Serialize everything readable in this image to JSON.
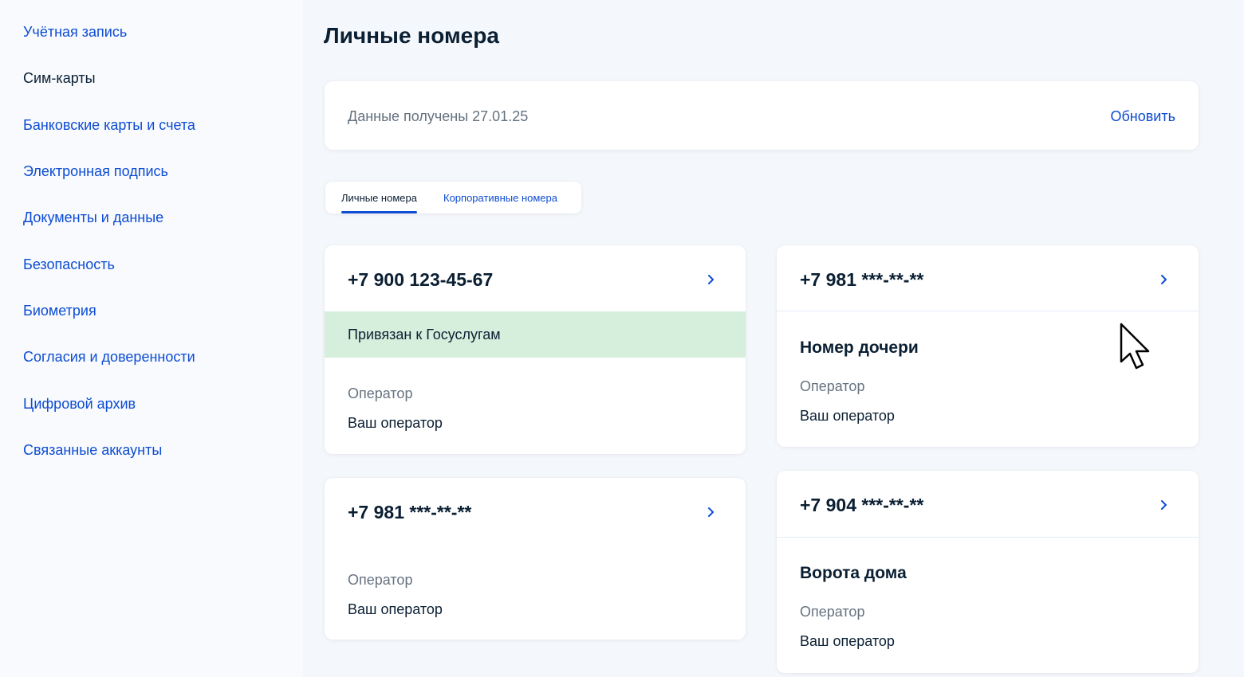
{
  "sidebar": {
    "items": [
      {
        "label": "Учётная запись"
      },
      {
        "label": "Сим-карты"
      },
      {
        "label": "Банковские карты и счета"
      },
      {
        "label": "Электронная подпись"
      },
      {
        "label": "Документы и данные"
      },
      {
        "label": "Безопасность"
      },
      {
        "label": "Биометрия"
      },
      {
        "label": "Согласия и доверенности"
      },
      {
        "label": "Цифровой архив"
      },
      {
        "label": "Связанные аккаунты"
      }
    ],
    "active_item": "Сим-карты"
  },
  "page": {
    "title": "Личные номера"
  },
  "status": {
    "text": "Данные получены 27.01.25",
    "refresh_label": "Обновить"
  },
  "tabs": {
    "personal": "Личные номера",
    "corporate": "Корпоративные номера",
    "active": "personal"
  },
  "phones": [
    {
      "number": "+7 900 123-45-67",
      "linked_text": "Привязан к Госуслугам",
      "operator_label": "Оператор",
      "operator_value": "Ваш оператор"
    },
    {
      "number": "+7 981 ***-**-**",
      "label": "Номер дочери",
      "operator_label": "Оператор",
      "operator_value": "Ваш оператор"
    },
    {
      "number": "+7 981 ***-**-**",
      "operator_label": "Оператор",
      "operator_value": "Ваш оператор"
    },
    {
      "number": "+7 904 ***-**-**",
      "label": "Ворота дома",
      "operator_label": "Оператор",
      "operator_value": "Ваш оператор"
    }
  ],
  "colors": {
    "accent": "#0d4cd3",
    "text": "#0b1f33",
    "muted": "#66727f",
    "linked_bg": "#d6efdc",
    "page_bg": "#f4f7fb"
  },
  "icons": {
    "chevron": "chevron-right-icon",
    "cursor": "mouse-pointer-icon"
  }
}
